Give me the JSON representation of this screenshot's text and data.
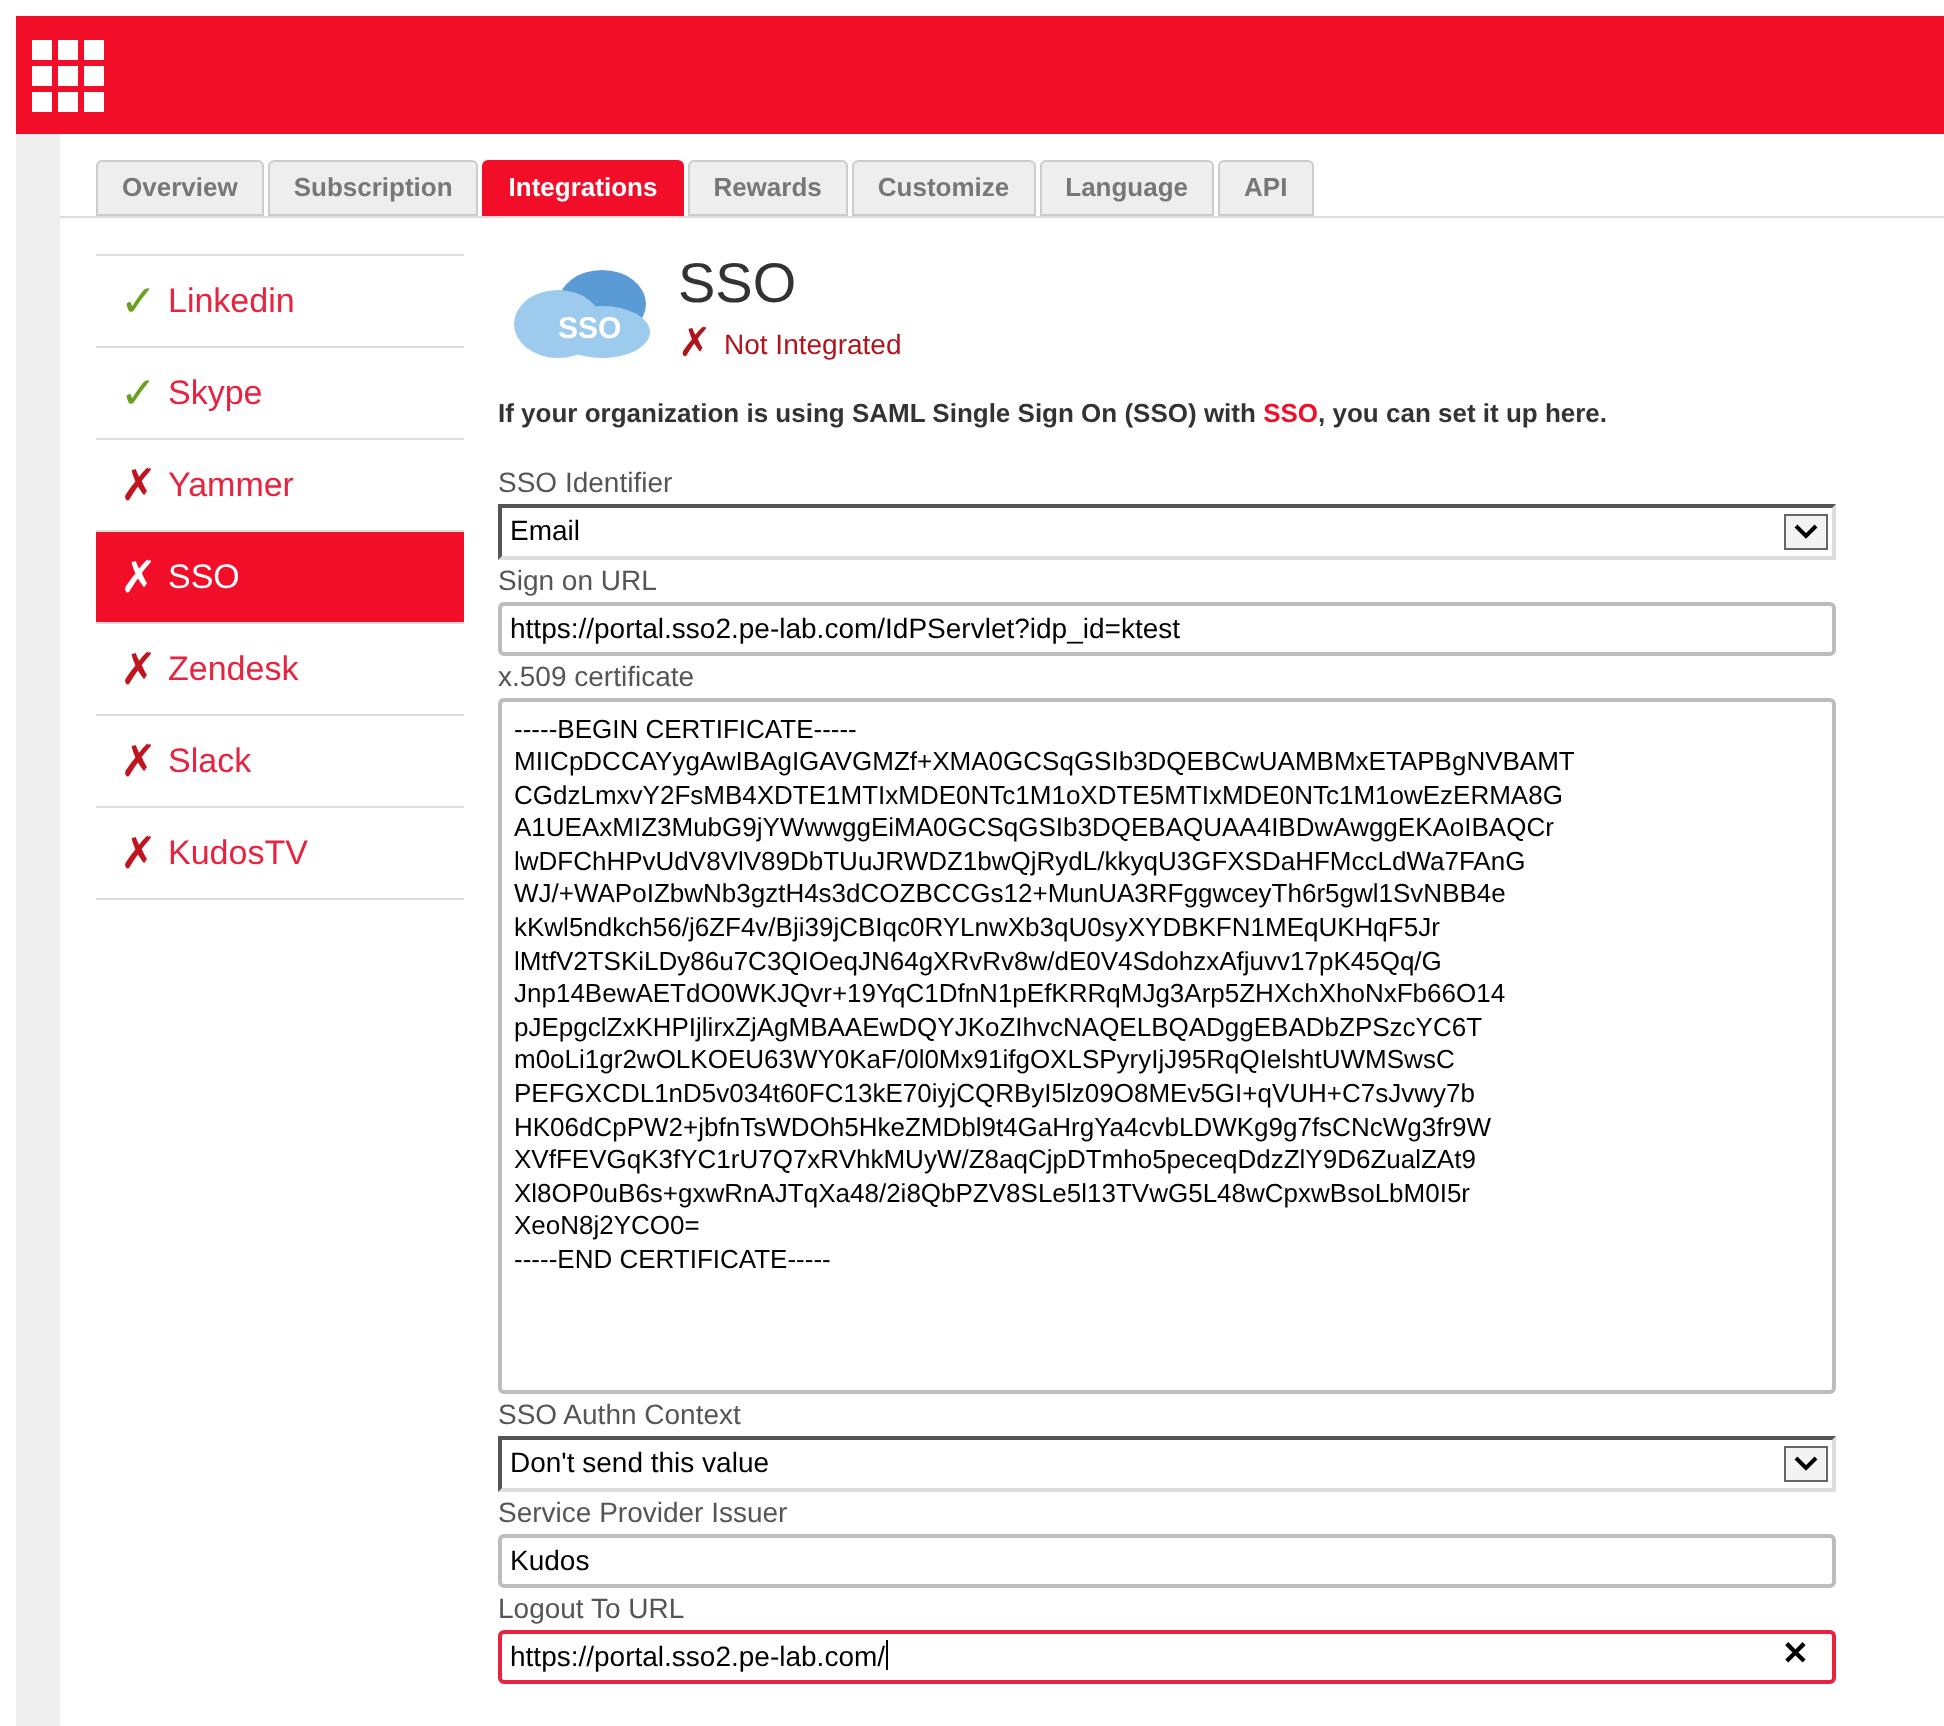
{
  "tabs": [
    {
      "label": "Overview",
      "selected": false
    },
    {
      "label": "Subscription",
      "selected": false
    },
    {
      "label": "Integrations",
      "selected": true
    },
    {
      "label": "Rewards",
      "selected": false
    },
    {
      "label": "Customize",
      "selected": false
    },
    {
      "label": "Language",
      "selected": false
    },
    {
      "label": "API",
      "selected": false
    }
  ],
  "sidebar": {
    "items": [
      {
        "mark": "✓",
        "label": "Linkedin",
        "integrated": true,
        "selected": false
      },
      {
        "mark": "✓",
        "label": "Skype",
        "integrated": true,
        "selected": false
      },
      {
        "mark": "✗",
        "label": "Yammer",
        "integrated": false,
        "selected": false
      },
      {
        "mark": "✗",
        "label": "SSO",
        "integrated": false,
        "selected": true
      },
      {
        "mark": "✗",
        "label": "Zendesk",
        "integrated": false,
        "selected": false
      },
      {
        "mark": "✗",
        "label": "Slack",
        "integrated": false,
        "selected": false
      },
      {
        "mark": "✗",
        "label": "KudosTV",
        "integrated": false,
        "selected": false
      }
    ]
  },
  "integration": {
    "logo_text": "SSO",
    "title": "SSO",
    "status_mark": "✗",
    "status": "Not Integrated",
    "description": "If your organization is using SAML Single Sign On (SSO) with **SSO**, you can set it up here."
  },
  "fields": [
    {
      "kind": "select",
      "label": "SSO Identifier",
      "value": "Email",
      "error": false
    },
    {
      "kind": "text",
      "label": "Sign on URL",
      "value": "https://portal.sso2.pe-lab.com/IdPServlet?idp_id=ktest",
      "error": false
    },
    {
      "kind": "textarea",
      "label": "x.509 certificate",
      "error": false,
      "lines": [
        "-----BEGIN CERTIFICATE-----",
        "MIICpDCCAYygAwIBAgIGAVGMZf+XMA0GCSqGSIb3DQEBCwUAMBMxETAPBgNVBAMT",
        "CGdzLmxvY2FsMB4XDTE1MTIxMDE0NTc1M1oXDTE5MTIxMDE0NTc1M1owEzERMA8G",
        "A1UEAxMIZ3MubG9jYWwwggEiMA0GCSqGSIb3DQEBAQUAA4IBDwAwggEKAoIBAQCr",
        "lwDFChHPvUdV8VlV89DbTUuJRWDZ1bwQjRydL/kkyqU3GFXSDaHFMccLdWa7FAnG",
        "WJ/+WAPoIZbwNb3gztH4s3dCOZBCCGs12+MunUA3RFggwceyTh6r5gwl1SvNBB4e",
        "kKwl5ndkch56/j6ZF4v/Bji39jCBIqc0RYLnwXb3qU0syXYDBKFN1MEqUKHqF5Jr",
        "lMtfV2TSKiLDy86u7C3QIOeqJN64gXRvRv8w/dE0V4SdohzxAfjuvv17pK45Qq/G",
        "Jnp14BewAETdO0WKJQvr+19YqC1DfnN1pEfKRRqMJg3Arp5ZHXchXhoNxFb66O14",
        "pJEpgclZxKHPIjlirxZjAgMBAAEwDQYJKoZIhvcNAQELBQADggEBADbZPSzcYC6T",
        "m0oLi1gr2wOLKOEU63WY0KaF/0l0Mx91ifgOXLSPyryIjJ95RqQIelshtUWMSwsC",
        "PEFGXCDL1nD5v034t60FC13kE70iyjCQRByI5lz09O8MEv5GI+qVUH+C7sJvwy7b",
        "HK06dCpPW2+jbfnTsWDOh5HkeZMDbl9t4GaHrgYa4cvbLDWKg9g7fsCNcWg3fr9W",
        "XVfFEVGqK3fYC1rU7Q7xRVhkMUyW/Z8aqCjpDTmho5peceqDdzZlY9D6ZualZAt9",
        "Xl8OP0uB6s+gxwRnAJTqXa48/2i8QbPZV8SLe5l13TVwG5L48wCpxwBsoLbM0I5r",
        "XeoN8j2YCO0=",
        "-----END CERTIFICATE-----"
      ]
    },
    {
      "kind": "select",
      "label": "SSO Authn Context",
      "value": "Don't send this value",
      "error": false
    },
    {
      "kind": "text",
      "label": "Service Provider Issuer",
      "value": "Kudos",
      "error": false
    },
    {
      "kind": "text",
      "label": "Logout To URL",
      "value": "https://portal.sso2.pe-lab.com/",
      "error": true,
      "clear": "✕"
    }
  ]
}
